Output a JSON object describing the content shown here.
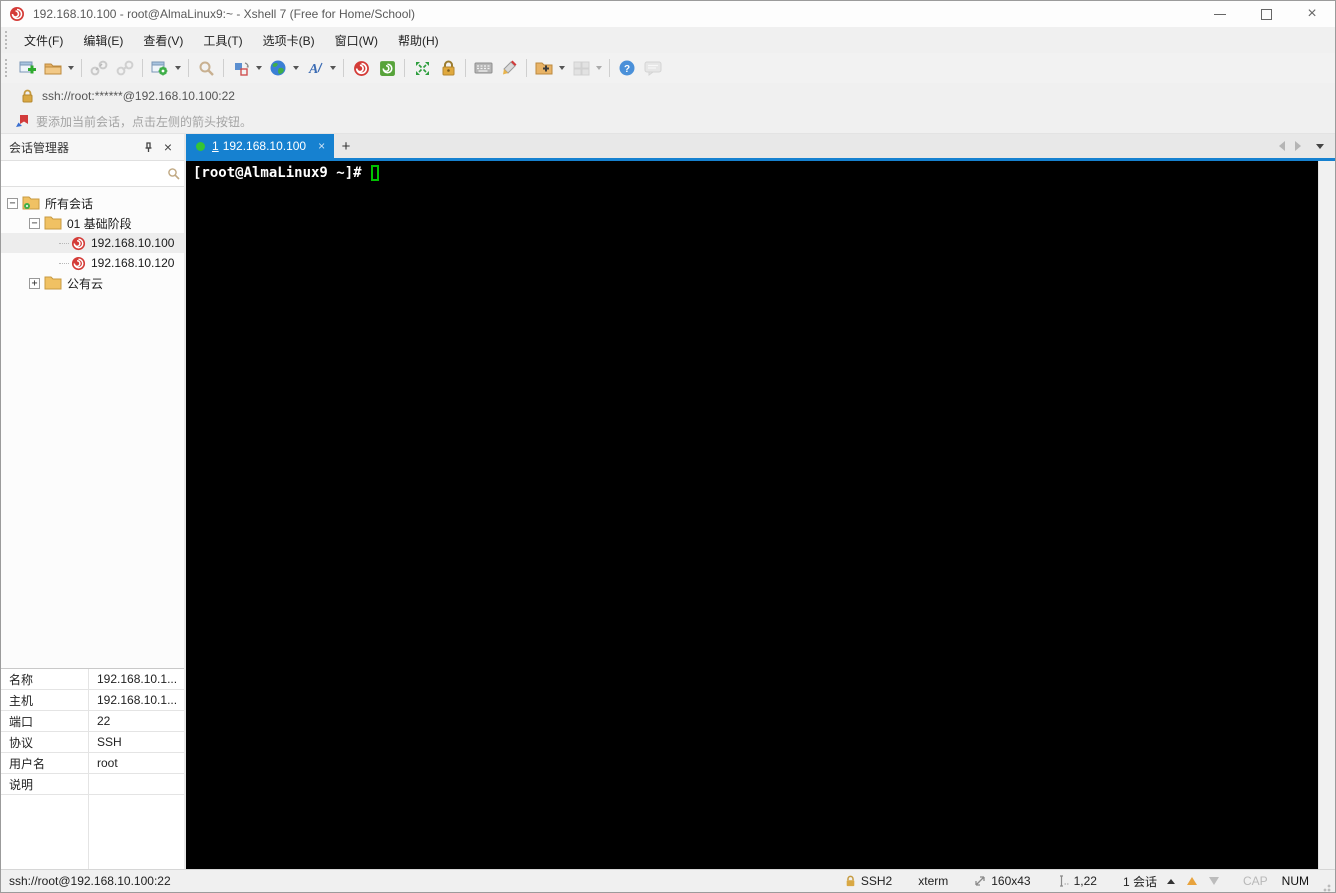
{
  "window": {
    "title": "192.168.10.100 - root@AlmaLinux9:~ - Xshell 7 (Free for Home/School)"
  },
  "menu": {
    "items": [
      {
        "label": "文件(F)"
      },
      {
        "label": "编辑(E)"
      },
      {
        "label": "查看(V)"
      },
      {
        "label": "工具(T)"
      },
      {
        "label": "选项卡(B)"
      },
      {
        "label": "窗口(W)"
      },
      {
        "label": "帮助(H)"
      }
    ]
  },
  "toolbar": {
    "icons": [
      "new-session-icon",
      "open-session-icon",
      "disconnect-icon",
      "reconnect-icon",
      "session-properties-icon",
      "find-icon",
      "compose-pane-icon",
      "web-icon",
      "font-icon",
      "xshell-icon",
      "xftp-icon",
      "fullscreen-icon",
      "lock-screen-icon",
      "virtual-keyboard-icon",
      "highlight-pen-icon",
      "new-folder-icon",
      "tile-windows-icon",
      "help-icon",
      "feedback-icon"
    ]
  },
  "address_bar": {
    "url": "ssh://root:******@192.168.10.100:22"
  },
  "info_bar": {
    "message": "要添加当前会话，点击左侧的箭头按钮。"
  },
  "session_manager": {
    "title": "会话管理器",
    "tree": {
      "root_label": "所有会话",
      "folder_basic": "01 基础阶段",
      "session_100": "192.168.10.100",
      "session_120": "192.168.10.120",
      "folder_cloud": "公有云"
    },
    "properties": {
      "rows": [
        {
          "label": "名称",
          "value": "192.168.10.1..."
        },
        {
          "label": "主机",
          "value": "192.168.10.1..."
        },
        {
          "label": "端口",
          "value": "22"
        },
        {
          "label": "协议",
          "value": "SSH"
        },
        {
          "label": "用户名",
          "value": "root"
        },
        {
          "label": "说明",
          "value": ""
        }
      ]
    }
  },
  "terminal": {
    "tab": {
      "index": "1",
      "host": "192.168.10.100",
      "close": "×",
      "new_tab": "+"
    },
    "prompt": "[root@AlmaLinux9 ~]# "
  },
  "status_bar": {
    "connection": "ssh://root@192.168.10.100:22",
    "protocol": "SSH2",
    "term_type": "xterm",
    "size": "160x43",
    "cursor_pos": "1,22",
    "sessions": "1 会话",
    "caps": "CAP",
    "num": "NUM"
  },
  "colors": {
    "accent_blue": "#1681d0",
    "terminal_green": "#00c200",
    "xshell_red": "#d43c38"
  }
}
